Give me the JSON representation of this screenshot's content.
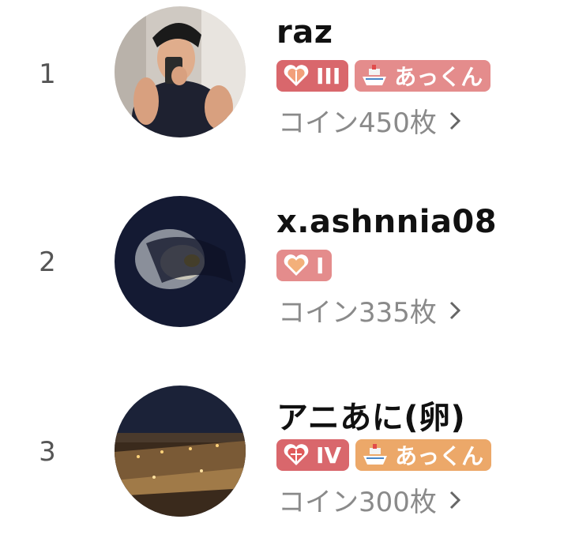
{
  "colors": {
    "badge_red": "#d9676c",
    "badge_rose": "#e48c8c",
    "badge_orange": "#eca869",
    "rank_text": "#555555",
    "coin_text": "#8a8a8a",
    "name_text": "#111111"
  },
  "rows": [
    {
      "rank": "1",
      "name": "raz",
      "level_badge": {
        "icon": "heart-icon",
        "label": "III",
        "color": "#d9676c"
      },
      "tag_badge": {
        "icon": "ship-icon",
        "label": "あっくん",
        "color": "#e48c8c"
      },
      "coins": "コイン450枚"
    },
    {
      "rank": "2",
      "name": "x.ashnnia08",
      "level_badge": {
        "icon": "heart-icon",
        "label": "I",
        "color": "#e48c8c"
      },
      "coins": "コイン335枚"
    },
    {
      "rank": "3",
      "name": "アニあに(卵)",
      "level_badge": {
        "icon": "heart-icon",
        "label": "IV",
        "color": "#d9676c"
      },
      "tag_badge": {
        "icon": "ship-icon",
        "label": "あっくん",
        "color": "#eca869"
      },
      "coins": "コイン300枚"
    }
  ]
}
